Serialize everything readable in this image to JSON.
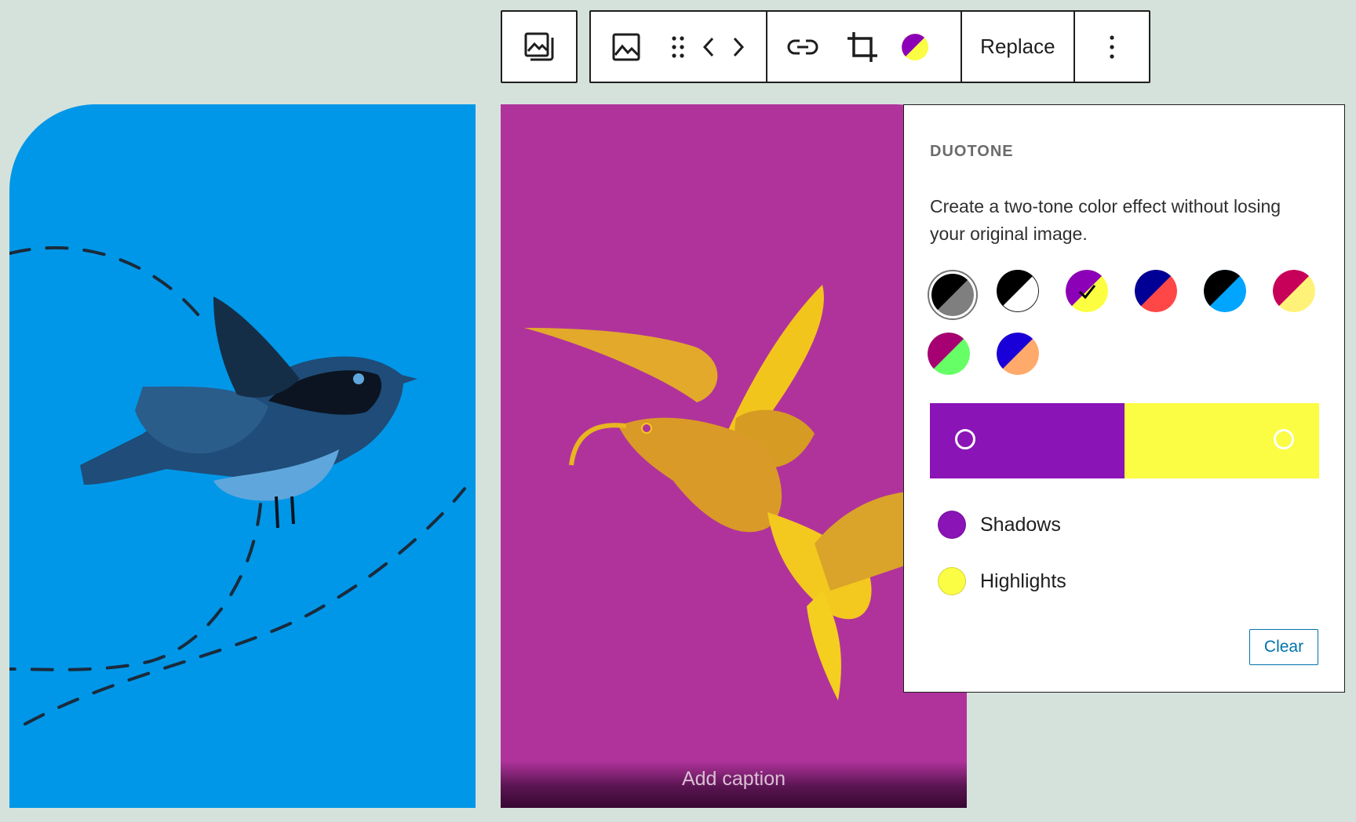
{
  "toolbar": {
    "replace_label": "Replace",
    "icons": [
      "image-block-icon",
      "image-icon",
      "drag-handle-icon",
      "move-left-icon",
      "move-right-icon",
      "link-icon",
      "crop-icon",
      "duotone-icon",
      "more-options-icon"
    ]
  },
  "left_image": {
    "background": "#0097e8",
    "subject": "bird"
  },
  "right_image": {
    "background": "#b0339c",
    "subject": "hummingbird",
    "caption_placeholder": "Add caption"
  },
  "duotone": {
    "heading": "DUOTONE",
    "description": "Create a two-tone color effect without losing your original image.",
    "presets": [
      {
        "name": "dark-grayscale",
        "shadow": "#000000",
        "highlight": "#7f7f7f",
        "selected": false
      },
      {
        "name": "grayscale",
        "shadow": "#000000",
        "highlight": "#ffffff",
        "selected": false
      },
      {
        "name": "purple-yellow",
        "shadow": "#8c00b7",
        "highlight": "#fcff41",
        "selected": true
      },
      {
        "name": "blue-red",
        "shadow": "#000097",
        "highlight": "#ff4747",
        "selected": false
      },
      {
        "name": "midnight",
        "shadow": "#000000",
        "highlight": "#00a5ff",
        "selected": false
      },
      {
        "name": "magenta-yellow",
        "shadow": "#c7005a",
        "highlight": "#fff278",
        "selected": false
      },
      {
        "name": "purple-green",
        "shadow": "#a60072",
        "highlight": "#67ff66",
        "selected": false
      },
      {
        "name": "blue-orange",
        "shadow": "#1900d8",
        "highlight": "#ffa96b",
        "selected": false
      }
    ],
    "gradient": {
      "shadow_color": "#8a14b6",
      "highlight_color": "#fbfc44"
    },
    "shadows_label": "Shadows",
    "highlights_label": "Highlights",
    "clear_label": "Clear"
  }
}
